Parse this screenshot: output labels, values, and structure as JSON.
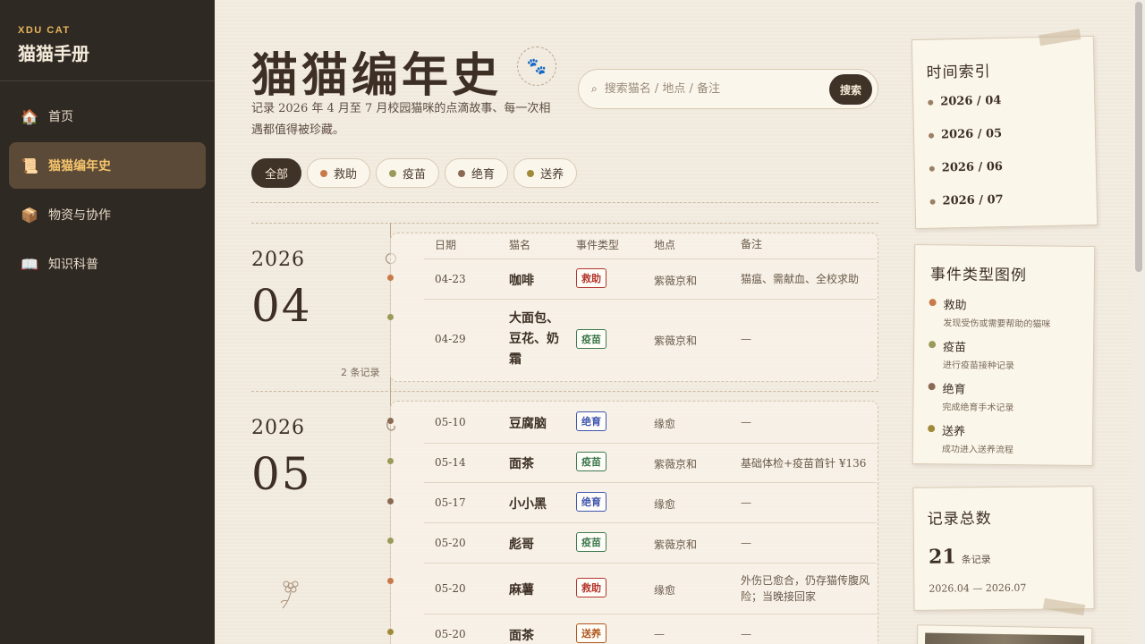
{
  "brand": {
    "tag": "XDU CAT",
    "name": "猫猫手册"
  },
  "nav": [
    {
      "label": "首页",
      "icon": "house-icon",
      "glyph": "🏠"
    },
    {
      "label": "猫猫编年史",
      "icon": "scroll-icon",
      "glyph": "📜"
    },
    {
      "label": "物资与协作",
      "icon": "package-icon",
      "glyph": "📦"
    },
    {
      "label": "知识科普",
      "icon": "book-icon",
      "glyph": "📖"
    }
  ],
  "header": {
    "title": "猫猫编年史",
    "subtitle": "记录 2026 年 4 月至 7 月校园猫咪的点滴故事、每一次相遇都值得被珍藏。",
    "paw": "🐾"
  },
  "search": {
    "placeholder": "搜索猫名 / 地点 / 备注",
    "button": "搜索",
    "icon": "⌕"
  },
  "filters": [
    {
      "label": "全部",
      "color": ""
    },
    {
      "label": "救助",
      "color": "#c87a4a"
    },
    {
      "label": "疫苗",
      "color": "#9a9a5a"
    },
    {
      "label": "绝育",
      "color": "#8a6a55"
    },
    {
      "label": "送养",
      "color": "#a08a3a"
    }
  ],
  "table_headers": {
    "date": "日期",
    "name": "猫名",
    "type": "事件类型",
    "place": "地点",
    "note": "备注"
  },
  "months": [
    {
      "year": "2026",
      "month": "04",
      "count": "2 条记录",
      "records": [
        {
          "date": "04-23",
          "name": "咖啡",
          "type": "救助",
          "place": "紫薇京和",
          "note": "猫瘟、需献血、全校求助"
        },
        {
          "date": "04-29",
          "name": "大面包、豆花、奶霜",
          "type": "疫苗",
          "place": "紫薇京和",
          "note": "—"
        }
      ]
    },
    {
      "year": "2026",
      "month": "05",
      "count": "",
      "records": [
        {
          "date": "05-10",
          "name": "豆腐脑",
          "type": "绝育",
          "place": "缘愈",
          "note": "—"
        },
        {
          "date": "05-14",
          "name": "面茶",
          "type": "疫苗",
          "place": "紫薇京和",
          "note": "基础体检+疫苗首针 ¥136"
        },
        {
          "date": "05-17",
          "name": "小小黑",
          "type": "绝育",
          "place": "缘愈",
          "note": "—"
        },
        {
          "date": "05-20",
          "name": "彪哥",
          "type": "疫苗",
          "place": "紫薇京和",
          "note": "—"
        },
        {
          "date": "05-20",
          "name": "麻薯",
          "type": "救助",
          "place": "缘愈",
          "note": "外伤已愈合，仍存猫传腹风险；当晚接回家"
        },
        {
          "date": "05-20",
          "name": "面茶",
          "type": "送养",
          "place": "—",
          "note": "—"
        }
      ]
    }
  ],
  "time_index": {
    "title": "时间索引",
    "items": [
      "2026 / 04",
      "2026 / 05",
      "2026 / 06",
      "2026 / 07"
    ]
  },
  "legend": {
    "title": "事件类型图例",
    "items": [
      {
        "name": "救助",
        "desc": "发现受伤或需要帮助的猫咪",
        "color": "#c87a4a"
      },
      {
        "name": "疫苗",
        "desc": "进行疫苗接种记录",
        "color": "#9a9a5a"
      },
      {
        "name": "绝育",
        "desc": "完成绝育手术记录",
        "color": "#8a6a55"
      },
      {
        "name": "送养",
        "desc": "成功进入送养流程",
        "color": "#a08a3a"
      }
    ]
  },
  "total": {
    "title": "记录总数",
    "number": "21",
    "unit": "条记录",
    "range": "2026.04 — 2026.07"
  },
  "colors": {
    "sidebar_bg": "#2f2924",
    "active_nav": "#5b4a38",
    "accent": "#f4c46b",
    "page_bg": "#f3ece0"
  }
}
